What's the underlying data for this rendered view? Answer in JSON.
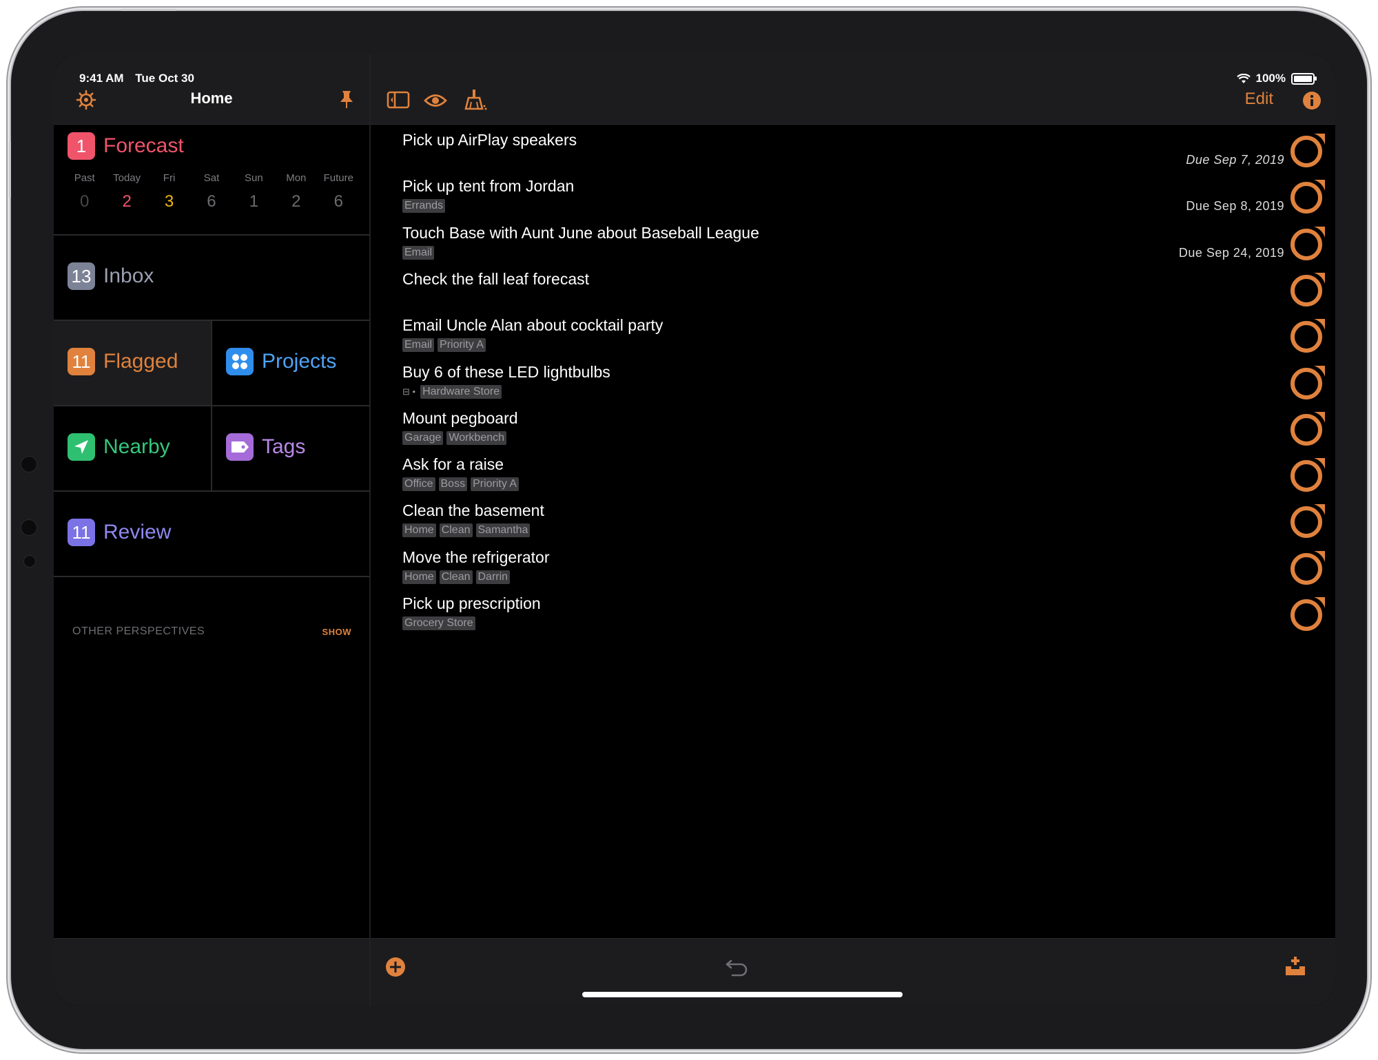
{
  "status": {
    "time": "9:41 AM",
    "date": "Tue Oct 30",
    "battery": "100%"
  },
  "sidebar": {
    "title": "Home",
    "forecast": {
      "count": "1",
      "label": "Forecast",
      "days": [
        {
          "name": "Past",
          "count": "0"
        },
        {
          "name": "Today",
          "count": "2"
        },
        {
          "name": "Fri",
          "count": "3"
        },
        {
          "name": "Sat",
          "count": "6"
        },
        {
          "name": "Sun",
          "count": "1"
        },
        {
          "name": "Mon",
          "count": "2"
        },
        {
          "name": "Future",
          "count": "6"
        }
      ]
    },
    "inbox": {
      "count": "13",
      "label": "Inbox"
    },
    "flagged": {
      "count": "11",
      "label": "Flagged"
    },
    "projects": {
      "label": "Projects"
    },
    "nearby": {
      "label": "Nearby"
    },
    "tags": {
      "label": "Tags"
    },
    "review": {
      "count": "11",
      "label": "Review"
    },
    "other_perspectives": "OTHER PERSPECTIVES",
    "show": "SHOW"
  },
  "toolbar": {
    "edit": "Edit"
  },
  "tasks": [
    {
      "title": "Pick up AirPlay speakers",
      "tags": [],
      "due": "Due Sep 7, 2019"
    },
    {
      "title": "Pick up tent from Jordan",
      "tags": [
        "Errands"
      ],
      "due": "Due Sep 8, 2019"
    },
    {
      "title": "Touch Base with Aunt June about Baseball League",
      "tags": [
        "Email"
      ],
      "due": "Due Sep 24, 2019"
    },
    {
      "title": "Check the fall leaf forecast",
      "tags": []
    },
    {
      "title": "Email Uncle Alan about cocktail party",
      "tags": [
        "Email",
        "Priority A"
      ]
    },
    {
      "title": "Buy 6 of these LED lightbulbs",
      "tags": [
        "Hardware Store"
      ],
      "note_indicator": "⊟ •"
    },
    {
      "title": "Mount pegboard",
      "tags": [
        "Garage",
        "Workbench"
      ]
    },
    {
      "title": "Ask for a raise",
      "tags": [
        "Office",
        "Boss",
        "Priority A"
      ]
    },
    {
      "title": "Clean the basement",
      "tags": [
        "Home",
        "Clean",
        "Samantha"
      ]
    },
    {
      "title": "Move the refrigerator",
      "tags": [
        "Home",
        "Clean",
        "Darrin"
      ]
    },
    {
      "title": "Pick up prescription",
      "tags": [
        "Grocery Store"
      ]
    }
  ],
  "colors": {
    "accent": "#e0823d",
    "forecast": "#f0546b",
    "today": "#f0546b",
    "fri": "#f0b814",
    "inbox": "#7d8396",
    "flagged": "#e0823d",
    "projects": "#2f8eec",
    "nearby": "#2fbf71",
    "tags": "#a56bd8",
    "review": "#7b72e6"
  }
}
